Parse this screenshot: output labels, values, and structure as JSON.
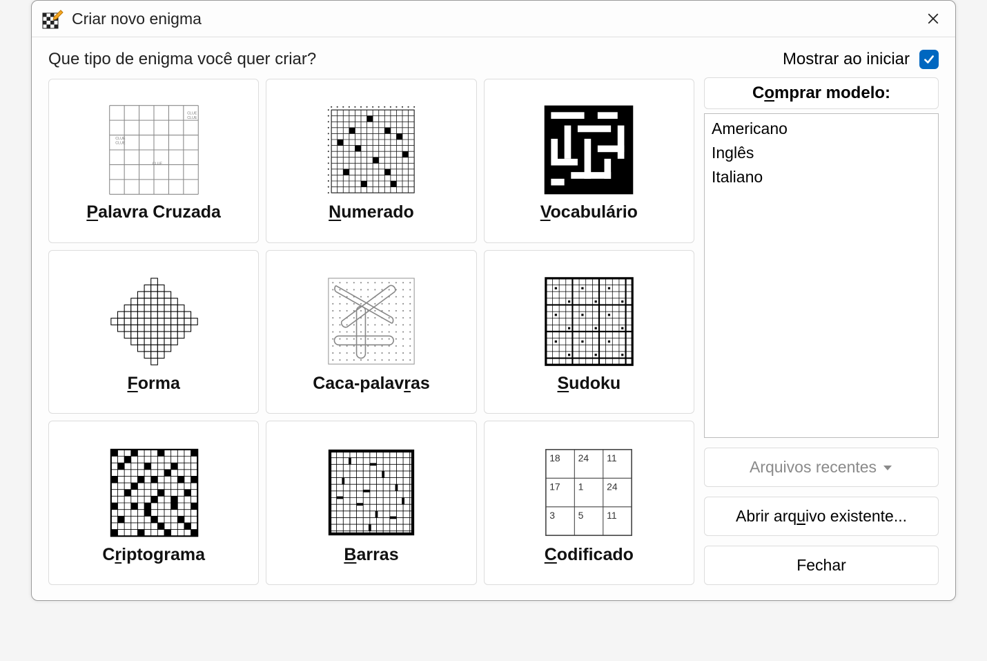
{
  "title": "Criar novo enigma",
  "prompt": "Que tipo de enigma você quer criar?",
  "show_on_startup_label": "Mostrar ao iniciar",
  "show_on_startup_checked": true,
  "buy_template_label": {
    "pre": "C",
    "u": "o",
    "post": "mprar modelo:"
  },
  "templates": [
    "Americano",
    "Inglês",
    "Italiano"
  ],
  "recent_files_label": "Arquivos recentes",
  "open_existing_label_parts": {
    "pre": "Abrir arq",
    "u": "u",
    "post": "ivo existente..."
  },
  "close_label": "Fechar",
  "tiles": [
    {
      "id": "crossword",
      "name": "tile-crossword",
      "label_parts": {
        "pre": "",
        "u": "P",
        "post": "alavra Cruzada"
      }
    },
    {
      "id": "numbered",
      "name": "tile-numbered",
      "label_parts": {
        "pre": "",
        "u": "N",
        "post": "umerado"
      }
    },
    {
      "id": "vocabulary",
      "name": "tile-vocabulary",
      "label_parts": {
        "pre": "",
        "u": "V",
        "post": "ocabulário"
      }
    },
    {
      "id": "shape",
      "name": "tile-shape",
      "label_parts": {
        "pre": "",
        "u": "F",
        "post": "orma"
      }
    },
    {
      "id": "wordsearch",
      "name": "tile-wordsearch",
      "label_parts": {
        "pre": "Caca-palav",
        "u": "r",
        "post": "as"
      }
    },
    {
      "id": "sudoku",
      "name": "tile-sudoku",
      "label_parts": {
        "pre": "",
        "u": "S",
        "post": "udoku"
      }
    },
    {
      "id": "cryptogram",
      "name": "tile-cryptogram",
      "label_parts": {
        "pre": "C",
        "u": "r",
        "post": "iptograma"
      }
    },
    {
      "id": "bars",
      "name": "tile-bars",
      "label_parts": {
        "pre": "",
        "u": "B",
        "post": "arras"
      }
    },
    {
      "id": "coded",
      "name": "tile-coded",
      "label_parts": {
        "pre": "",
        "u": "C",
        "post": "odificado"
      },
      "cells": [
        [
          "18",
          "24",
          "11"
        ],
        [
          "17",
          "1",
          "24"
        ],
        [
          "3",
          "5",
          "11"
        ]
      ]
    }
  ]
}
